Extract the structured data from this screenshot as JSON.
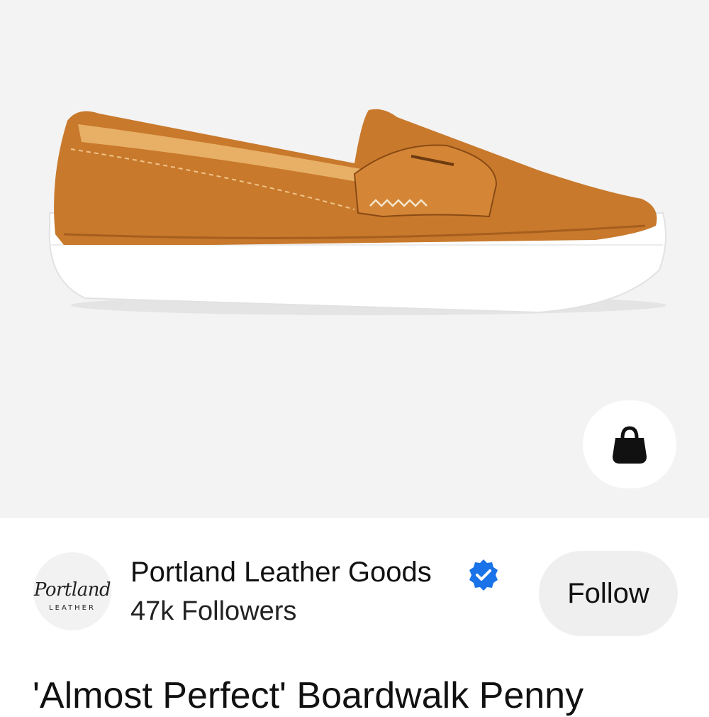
{
  "product": {
    "image_alt": "loafer-shoe",
    "title": "'Almost Perfect' Boardwalk Penny"
  },
  "shop_button": {
    "icon": "shopping-bag-icon"
  },
  "brand": {
    "name": "Portland Leather Goods",
    "followers": "47k Followers",
    "logo_script": "Portland",
    "logo_sub": "LEATHER",
    "verified_icon": "verified-badge-icon",
    "verified_color": "#1a73e8"
  },
  "follow_button": {
    "label": "Follow"
  },
  "colors": {
    "hero_bg": "#f3f3f3",
    "leather": "#c8792c",
    "sole": "#ffffff"
  }
}
